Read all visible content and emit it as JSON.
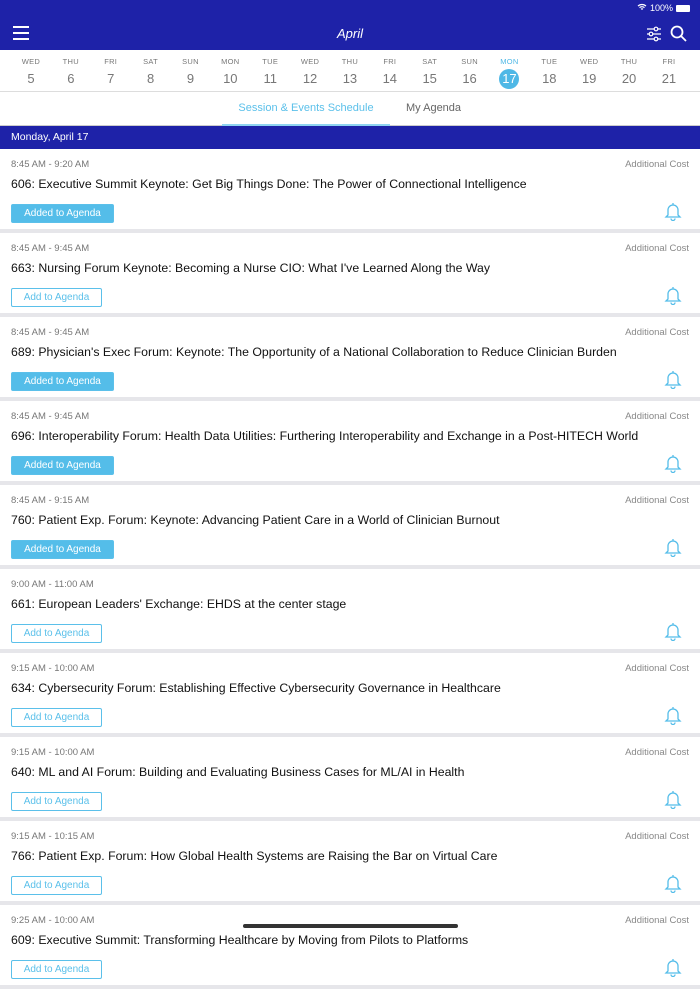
{
  "status": {
    "battery": "100%"
  },
  "header": {
    "title": "April"
  },
  "dates": [
    {
      "dow": "WED",
      "num": "5"
    },
    {
      "dow": "THU",
      "num": "6"
    },
    {
      "dow": "FRI",
      "num": "7"
    },
    {
      "dow": "SAT",
      "num": "8"
    },
    {
      "dow": "SUN",
      "num": "9"
    },
    {
      "dow": "MON",
      "num": "10"
    },
    {
      "dow": "TUE",
      "num": "11"
    },
    {
      "dow": "WED",
      "num": "12"
    },
    {
      "dow": "THU",
      "num": "13"
    },
    {
      "dow": "FRI",
      "num": "14"
    },
    {
      "dow": "SAT",
      "num": "15"
    },
    {
      "dow": "SUN",
      "num": "16"
    },
    {
      "dow": "MON",
      "num": "17",
      "selected": true
    },
    {
      "dow": "TUE",
      "num": "18"
    },
    {
      "dow": "WED",
      "num": "19"
    },
    {
      "dow": "THU",
      "num": "20"
    },
    {
      "dow": "FRI",
      "num": "21"
    }
  ],
  "tabs": {
    "schedule": "Session & Events Schedule",
    "agenda": "My Agenda"
  },
  "day_header": "Monday, April 17",
  "sessions": [
    {
      "time": "8:45 AM - 9:20 AM",
      "cost": "Additional Cost",
      "title": "606: Executive Summit Keynote: Get Big Things Done: The Power of Connectional Intelligence",
      "button": "Added to Agenda",
      "added": true
    },
    {
      "time": "8:45 AM - 9:45 AM",
      "cost": "Additional Cost",
      "title": "663: Nursing Forum Keynote: Becoming a Nurse CIO: What I've Learned Along the Way",
      "button": "Add to Agenda",
      "added": false
    },
    {
      "time": "8:45 AM - 9:45 AM",
      "cost": "Additional Cost",
      "title": "689: Physician's Exec Forum: Keynote: The Opportunity of a National Collaboration to Reduce Clinician Burden",
      "button": "Added to Agenda",
      "added": true
    },
    {
      "time": "8:45 AM - 9:45 AM",
      "cost": "Additional Cost",
      "title": "696: Interoperability Forum: Health Data Utilities: Furthering Interoperability and Exchange in a Post-HITECH World",
      "button": "Added to Agenda",
      "added": true
    },
    {
      "time": "8:45 AM - 9:15 AM",
      "cost": "Additional Cost",
      "title": "760: Patient Exp. Forum: Keynote: Advancing Patient Care in a World of Clinician Burnout",
      "button": "Added to Agenda",
      "added": true
    },
    {
      "time": "9:00 AM - 11:00 AM",
      "cost": "",
      "title": "661: European Leaders' Exchange: EHDS at the center stage",
      "button": "Add to Agenda",
      "added": false
    },
    {
      "time": "9:15 AM - 10:00 AM",
      "cost": "Additional Cost",
      "title": "634: Cybersecurity Forum: Establishing Effective Cybersecurity Governance in Healthcare",
      "button": "Add to Agenda",
      "added": false
    },
    {
      "time": "9:15 AM - 10:00 AM",
      "cost": "Additional Cost",
      "title": "640: ML and AI Forum: Building and Evaluating Business Cases for ML/AI in Health",
      "button": "Add to Agenda",
      "added": false
    },
    {
      "time": "9:15 AM - 10:15 AM",
      "cost": "Additional Cost",
      "title": "766: Patient Exp. Forum: How Global Health Systems are Raising the Bar on Virtual Care",
      "button": "Add to Agenda",
      "added": false
    },
    {
      "time": "9:25 AM - 10:00 AM",
      "cost": "Additional Cost",
      "title": "609: Executive Summit: Transforming Healthcare by Moving from Pilots to Platforms",
      "button": "Add to Agenda",
      "added": false
    }
  ]
}
